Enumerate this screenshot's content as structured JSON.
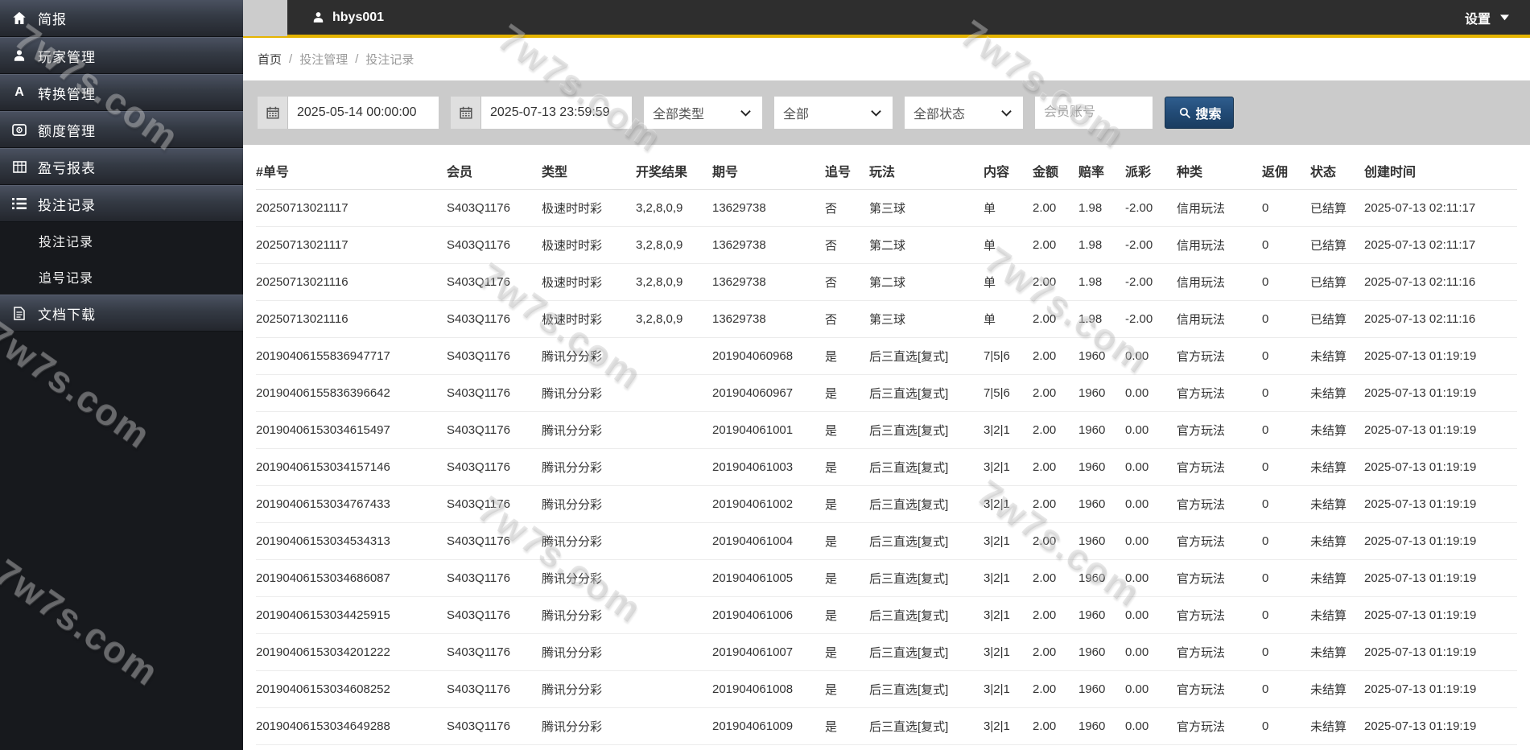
{
  "topbar": {
    "username": "hbys001",
    "settings_label": "设置"
  },
  "sidebar": {
    "items": [
      {
        "key": "briefing",
        "label": "简报",
        "icon": "home-icon",
        "type": "item"
      },
      {
        "key": "player-management",
        "label": "玩家管理",
        "icon": "user-icon",
        "type": "item"
      },
      {
        "key": "conversion-management",
        "label": "转换管理",
        "icon": "letter-a-icon",
        "type": "item"
      },
      {
        "key": "quota-management",
        "label": "额度管理",
        "icon": "quota-icon",
        "type": "item"
      },
      {
        "key": "profit-loss-report",
        "label": "盈亏报表",
        "icon": "table-icon",
        "type": "item"
      },
      {
        "key": "betting-records",
        "label": "投注记录",
        "icon": "list-icon",
        "type": "item",
        "active": true
      },
      {
        "key": "betting-records-sub",
        "label": "投注记录",
        "type": "subitem"
      },
      {
        "key": "chase-number-records",
        "label": "追号记录",
        "type": "subitem"
      },
      {
        "key": "document-download",
        "label": "文档下载",
        "icon": "document-icon",
        "type": "item"
      }
    ]
  },
  "breadcrumb": {
    "items": [
      "首页",
      "投注管理",
      "投注记录"
    ]
  },
  "filters": {
    "date_from": "2025-05-14 00:00:00",
    "date_to": "2025-07-13 23:59:59",
    "type_select": "全部类型",
    "lottery_select": "全部",
    "status_select": "全部状态",
    "member_placeholder": "会员账号",
    "search_label": "搜索"
  },
  "table": {
    "columns": [
      "#单号",
      "会员",
      "类型",
      "开奖结果",
      "期号",
      "追号",
      "玩法",
      "内容",
      "金额",
      "赔率",
      "派彩",
      "种类",
      "返佣",
      "状态",
      "创建时间"
    ],
    "rows": [
      [
        "20250713021117",
        "S403Q1176",
        "极速时时彩",
        "3,2,8,0,9",
        "13629738",
        "否",
        "第三球",
        "单",
        "2.00",
        "1.98",
        "-2.00",
        "信用玩法",
        "0",
        "已结算",
        "2025-07-13 02:11:17"
      ],
      [
        "20250713021117",
        "S403Q1176",
        "极速时时彩",
        "3,2,8,0,9",
        "13629738",
        "否",
        "第二球",
        "单",
        "2.00",
        "1.98",
        "-2.00",
        "信用玩法",
        "0",
        "已结算",
        "2025-07-13 02:11:17"
      ],
      [
        "20250713021116",
        "S403Q1176",
        "极速时时彩",
        "3,2,8,0,9",
        "13629738",
        "否",
        "第二球",
        "单",
        "2.00",
        "1.98",
        "-2.00",
        "信用玩法",
        "0",
        "已结算",
        "2025-07-13 02:11:16"
      ],
      [
        "20250713021116",
        "S403Q1176",
        "极速时时彩",
        "3,2,8,0,9",
        "13629738",
        "否",
        "第三球",
        "单",
        "2.00",
        "1.98",
        "-2.00",
        "信用玩法",
        "0",
        "已结算",
        "2025-07-13 02:11:16"
      ],
      [
        "20190406155836947717",
        "S403Q1176",
        "腾讯分分彩",
        "",
        "201904060968",
        "是",
        "后三直选[复式]",
        "7|5|6",
        "2.00",
        "1960",
        "0.00",
        "官方玩法",
        "0",
        "未结算",
        "2025-07-13 01:19:19"
      ],
      [
        "20190406155836396642",
        "S403Q1176",
        "腾讯分分彩",
        "",
        "201904060967",
        "是",
        "后三直选[复式]",
        "7|5|6",
        "2.00",
        "1960",
        "0.00",
        "官方玩法",
        "0",
        "未结算",
        "2025-07-13 01:19:19"
      ],
      [
        "20190406153034615497",
        "S403Q1176",
        "腾讯分分彩",
        "",
        "201904061001",
        "是",
        "后三直选[复式]",
        "3|2|1",
        "2.00",
        "1960",
        "0.00",
        "官方玩法",
        "0",
        "未结算",
        "2025-07-13 01:19:19"
      ],
      [
        "20190406153034157146",
        "S403Q1176",
        "腾讯分分彩",
        "",
        "201904061003",
        "是",
        "后三直选[复式]",
        "3|2|1",
        "2.00",
        "1960",
        "0.00",
        "官方玩法",
        "0",
        "未结算",
        "2025-07-13 01:19:19"
      ],
      [
        "20190406153034767433",
        "S403Q1176",
        "腾讯分分彩",
        "",
        "201904061002",
        "是",
        "后三直选[复式]",
        "3|2|1",
        "2.00",
        "1960",
        "0.00",
        "官方玩法",
        "0",
        "未结算",
        "2025-07-13 01:19:19"
      ],
      [
        "20190406153034534313",
        "S403Q1176",
        "腾讯分分彩",
        "",
        "201904061004",
        "是",
        "后三直选[复式]",
        "3|2|1",
        "2.00",
        "1960",
        "0.00",
        "官方玩法",
        "0",
        "未结算",
        "2025-07-13 01:19:19"
      ],
      [
        "20190406153034686087",
        "S403Q1176",
        "腾讯分分彩",
        "",
        "201904061005",
        "是",
        "后三直选[复式]",
        "3|2|1",
        "2.00",
        "1960",
        "0.00",
        "官方玩法",
        "0",
        "未结算",
        "2025-07-13 01:19:19"
      ],
      [
        "20190406153034425915",
        "S403Q1176",
        "腾讯分分彩",
        "",
        "201904061006",
        "是",
        "后三直选[复式]",
        "3|2|1",
        "2.00",
        "1960",
        "0.00",
        "官方玩法",
        "0",
        "未结算",
        "2025-07-13 01:19:19"
      ],
      [
        "20190406153034201222",
        "S403Q1176",
        "腾讯分分彩",
        "",
        "201904061007",
        "是",
        "后三直选[复式]",
        "3|2|1",
        "2.00",
        "1960",
        "0.00",
        "官方玩法",
        "0",
        "未结算",
        "2025-07-13 01:19:19"
      ],
      [
        "20190406153034608252",
        "S403Q1176",
        "腾讯分分彩",
        "",
        "201904061008",
        "是",
        "后三直选[复式]",
        "3|2|1",
        "2.00",
        "1960",
        "0.00",
        "官方玩法",
        "0",
        "未结算",
        "2025-07-13 01:19:19"
      ],
      [
        "20190406153034649288",
        "S403Q1176",
        "腾讯分分彩",
        "",
        "201904061009",
        "是",
        "后三直选[复式]",
        "3|2|1",
        "2.00",
        "1960",
        "0.00",
        "官方玩法",
        "0",
        "未结算",
        "2025-07-13 01:19:19"
      ]
    ]
  },
  "watermark_text": "7w7s.com",
  "colors": {
    "accent_gold": "#e5b400",
    "search_button_blue": "#224b76",
    "topbar_dark": "#2e2e2e",
    "sidebar_dark": "#17191d",
    "filter_gray": "#cbcbcb"
  }
}
